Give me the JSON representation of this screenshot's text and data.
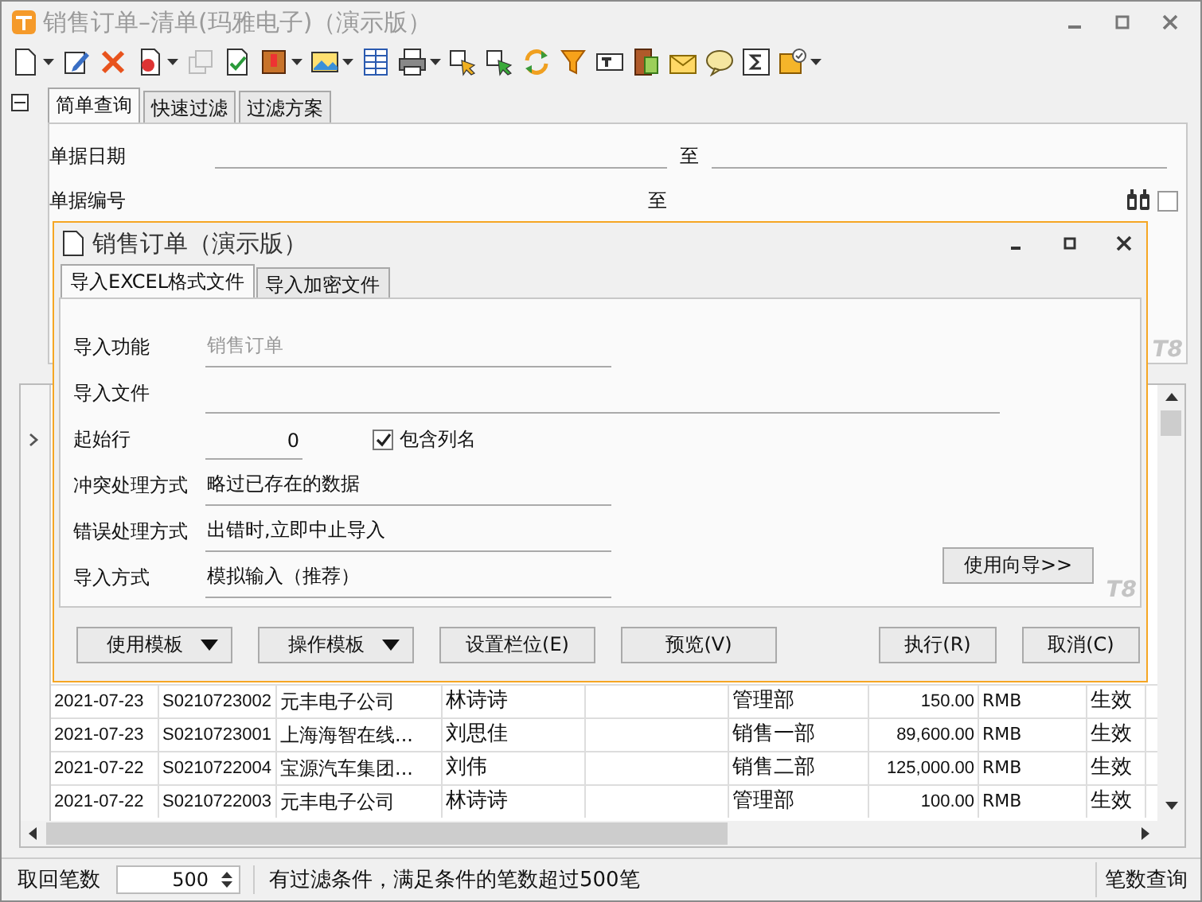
{
  "window": {
    "title": "销售订单–清单(玛雅电子)（演示版）"
  },
  "query_tabs": [
    {
      "label": "简单查询",
      "selected": true
    },
    {
      "label": "快速过滤",
      "selected": false
    },
    {
      "label": "过滤方案",
      "selected": false
    }
  ],
  "query_fields": [
    {
      "label": "单据日期",
      "kind": "range",
      "separator": "至"
    },
    {
      "label": "单据编号",
      "kind": "lookup",
      "separator": "至",
      "checked": false
    }
  ],
  "query_brand": "T8",
  "table": {
    "rows": [
      {
        "date": "2021-07-23",
        "code": "S0210723002",
        "customer": "元丰电子公司",
        "person": "林诗诗",
        "dept": "管理部",
        "amount": "150.00",
        "currency": "RMB",
        "status": "生效"
      },
      {
        "date": "2021-07-23",
        "code": "S0210723001",
        "customer": "上海海智在线...",
        "person": "刘思佳",
        "dept": "销售一部",
        "amount": "89,600.00",
        "currency": "RMB",
        "status": "生效"
      },
      {
        "date": "2021-07-22",
        "code": "S0210722004",
        "customer": "宝源汽车集团...",
        "person": "刘伟",
        "dept": "销售二部",
        "amount": "125,000.00",
        "currency": "RMB",
        "status": "生效"
      },
      {
        "date": "2021-07-22",
        "code": "S0210722003",
        "customer": "元丰电子公司",
        "person": "林诗诗",
        "dept": "管理部",
        "amount": "100.00",
        "currency": "RMB",
        "status": "生效"
      }
    ]
  },
  "status_bar": {
    "label": "取回笔数",
    "count": "500",
    "message": "有过滤条件，满足条件的笔数超过500笔",
    "button": "笔数查询"
  },
  "dialog": {
    "title": "销售订单（演示版）",
    "tabs": [
      {
        "label": "导入EXCEL格式文件",
        "selected": true
      },
      {
        "label": "导入加密文件",
        "selected": false
      }
    ],
    "fields": [
      {
        "label": "导入功能",
        "kind": "text",
        "value": "销售订单",
        "disabled": true
      },
      {
        "label": "导入文件",
        "kind": "long"
      },
      {
        "label": "起始行",
        "kind": "number",
        "value": "0",
        "checkbox": {
          "label": "包含列名",
          "checked": true
        }
      },
      {
        "label": "冲突处理方式",
        "kind": "text",
        "value": "略过已存在的数据",
        "disabled": false
      },
      {
        "label": "错误处理方式",
        "kind": "text",
        "value": "出错时,立即中止导入",
        "disabled": false
      },
      {
        "label": "导入方式",
        "kind": "text",
        "value": "模拟输入（推荐）",
        "disabled": false
      }
    ],
    "wizard_button": "使用向导>>",
    "brand": "T8",
    "buttons": [
      {
        "label": "使用模板",
        "kind": "menu"
      },
      {
        "label": "操作模板",
        "kind": "menu"
      },
      {
        "label": "设置栏位(E)",
        "kind": "plain"
      },
      {
        "label": "预览(V)",
        "kind": "plain"
      },
      {
        "label": "执行(R)",
        "kind": "plain"
      },
      {
        "label": "取消(C)",
        "kind": "plain"
      }
    ]
  }
}
